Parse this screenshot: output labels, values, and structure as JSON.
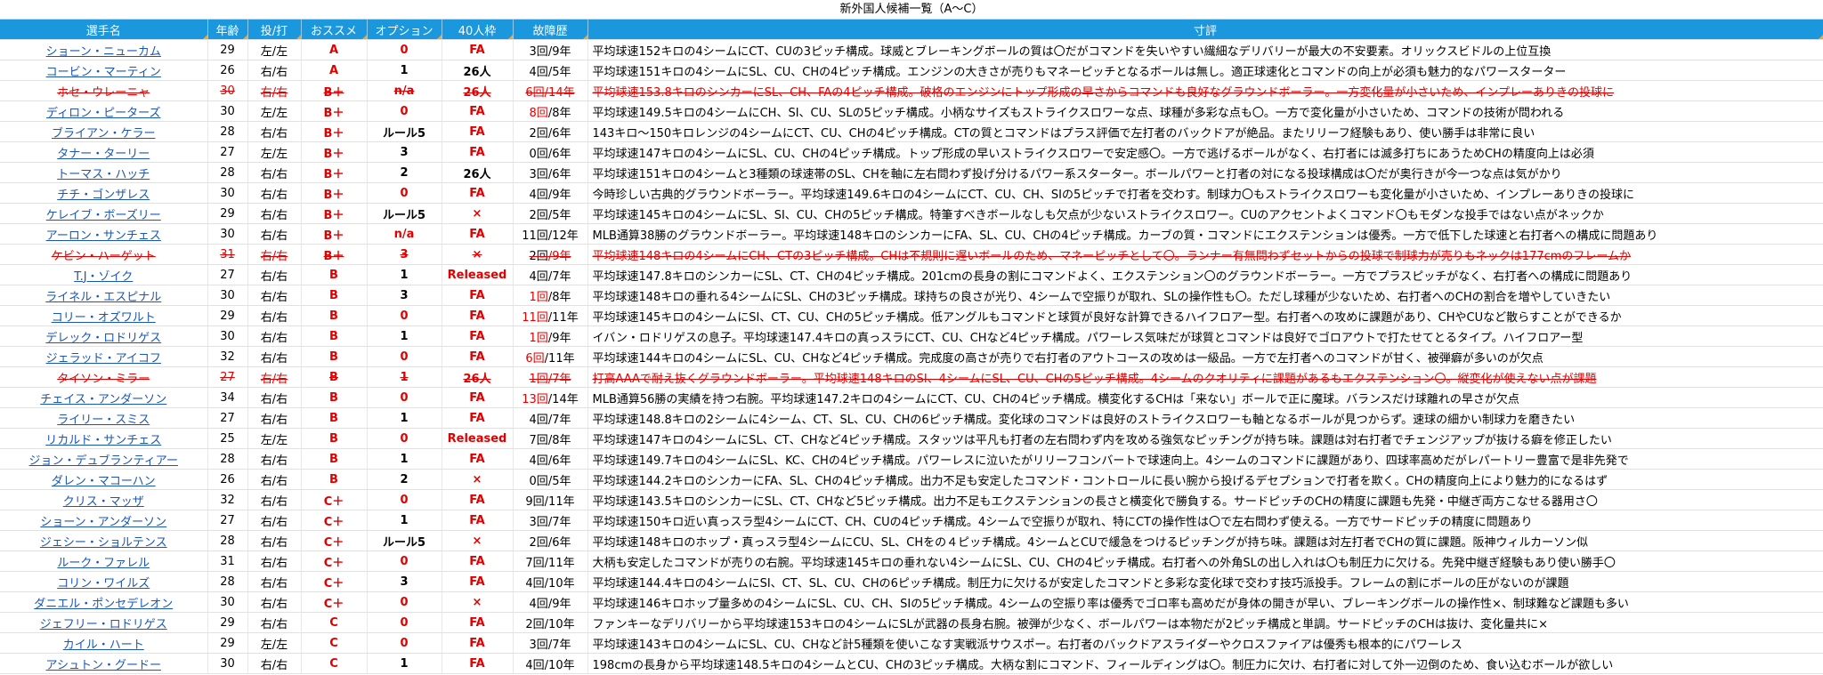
{
  "title": "新外国人候補一覧（A〜C）",
  "headers": [
    "選手名",
    "年齢",
    "投/打",
    "おススメ",
    "オプション",
    "40人枠",
    "故障歴",
    "寸評"
  ],
  "rows": [
    {
      "name": "ショーン・ニューカム",
      "age": "29",
      "hand": "左/左",
      "grade": "A",
      "option": "0",
      "option_color": "red",
      "slot": "FA",
      "slot_color": "red",
      "inj_y": "3回",
      "inj_r": "/9年",
      "comment": "平均球速152キロの4シームにCT、CUの3ピッチ構成。球威とブレーキングボールの質は〇だがコマンドを失いやすい繊細なデリバリーが最大の不安要素。オリックスビドルの上位互換",
      "struck": false
    },
    {
      "name": "コービン・マーティン",
      "age": "26",
      "hand": "右/右",
      "grade": "A",
      "option": "1",
      "option_color": "black",
      "slot": "26人",
      "slot_color": "black",
      "inj_y": "4回",
      "inj_r": "/5年",
      "comment": "平均球速151キロの4シームにSL、CU、CHの4ピッチ構成。エンジンの大きさが売りもマネーピッチとなるボールは無し。適正球速化とコマンドの向上が必須も魅力的なパワースターター",
      "struck": false
    },
    {
      "name": "ホセ・ウレーニャ",
      "age": "30",
      "hand": "右/右",
      "grade": "B＋",
      "option": "n/a",
      "option_color": "red",
      "slot": "26人",
      "slot_color": "black",
      "inj_y": "6回",
      "inj_r": "/14年",
      "comment": "平均球速153.8キロのシンカーにSL、CH、FAの4ピッチ構成。破格のエンジンにトップ形成の早さからコマンドも良好なグラウンドボーラー。一方変化量が小さいため、インプレーありきの投球に",
      "struck": true
    },
    {
      "name": "ディロン・ピーターズ",
      "age": "30",
      "hand": "左/左",
      "grade": "B＋",
      "option": "0",
      "option_color": "red",
      "slot": "FA",
      "slot_color": "red",
      "inj_y": "8回",
      "inj_r": "/8年",
      "comment": "平均球速149.5キロの4シームにCH、SI、CU、SLの5ピッチ構成。小柄なサイズもストライクスロワーな点、球種が多彩な点も〇。一方で変化量が小さいため、コマンドの技術が問われる",
      "struck": false
    },
    {
      "name": "ブライアン・ケラー",
      "age": "28",
      "hand": "右/右",
      "grade": "B＋",
      "option": "ルール5",
      "option_color": "black",
      "slot": "FA",
      "slot_color": "red",
      "inj_y": "2回",
      "inj_r": "/6年",
      "comment": "143キロ〜150キロレンジの4シームにCT、CU、CHの4ピッチ構成。CTの質とコマンドはプラス評価で左打者のバックドアが絶品。またリリーフ経験もあり、使い勝手は非常に良い",
      "struck": false
    },
    {
      "name": "タナー・ターリー",
      "age": "27",
      "hand": "左/左",
      "grade": "B＋",
      "option": "3",
      "option_color": "black",
      "slot": "FA",
      "slot_color": "red",
      "inj_y": "0回",
      "inj_r": "/6年",
      "comment": "平均球速147キロの4シームにSL、CU、CHの4ピッチ構成。トップ形成の早いストライクスロワーで安定感〇。一方で逃げるボールがなく、右打者には滅多打ちにあうためCHの精度向上は必須",
      "struck": false
    },
    {
      "name": "トーマス・ハッチ",
      "age": "28",
      "hand": "右/右",
      "grade": "B＋",
      "option": "2",
      "option_color": "black",
      "slot": "26人",
      "slot_color": "black",
      "inj_y": "3回",
      "inj_r": "/6年",
      "comment": "平均球速151キロの4シームと3種類の球速帯のSL、CHを軸に左右問わず投げ分けるパワー系スターター。ボールパワーと打者の対になる投球構成は〇だが奥行きが今一つな点は気がかり",
      "struck": false
    },
    {
      "name": "チチ・ゴンザレス",
      "age": "30",
      "hand": "右/右",
      "grade": "B＋",
      "option": "0",
      "option_color": "red",
      "slot": "FA",
      "slot_color": "red",
      "inj_y": "4回",
      "inj_r": "/9年",
      "comment": "今時珍しい古典的グラウンドボーラー。平均球速149.6キロの4シームにCT、CU、CH、SIの5ピッチで打者を交わす。制球力〇もストライクスロワーも変化量が小さいため、インプレーありきの投球に",
      "struck": false
    },
    {
      "name": "ケレイブ・ボーズリー",
      "age": "29",
      "hand": "右/右",
      "grade": "B＋",
      "option": "ルール5",
      "option_color": "black",
      "slot": "×",
      "slot_color": "red",
      "inj_y": "2回",
      "inj_r": "/5年",
      "comment": "平均球速145キロの4シームにSL、SI、CU、CHの5ピッチ構成。特筆すべきボールなしも欠点が少ないストライクスロワー。CUのアクセントよくコマンド〇もモダンな投手ではない点がネックか",
      "struck": false
    },
    {
      "name": "アーロン・サンチェス",
      "age": "30",
      "hand": "右/右",
      "grade": "B＋",
      "option": "n/a",
      "option_color": "red",
      "slot": "FA",
      "slot_color": "red",
      "inj_y": "11回",
      "inj_r": "/12年",
      "comment": "MLB通算38勝のグラウンドボーラー。平均球速148キロのシンカーにFA、SL、CU、CHの4ピッチ構成。カーブの質・コマンドにエクステンションは優秀。一方で低下した球速と右打者への構成に問題あり",
      "struck": false
    },
    {
      "name": "ケビン・ハーゲット",
      "age": "31",
      "hand": "右/右",
      "grade": "B＋",
      "option": "3",
      "option_color": "black",
      "slot": "×",
      "slot_color": "red",
      "inj_y": "2回",
      "inj_r": "/9年",
      "comment": "平均球速148キロの4シームにCH、CTの3ピッチ構成。CHは不規則に遅いボールのため、マネーピッチとして〇。ランナー有無問わずセットからの投球で制球力が売りもネックは177cmのフレームか",
      "struck": true
    },
    {
      "name": "T.J・ゾイク",
      "age": "27",
      "hand": "右/右",
      "grade": "B",
      "option": "1",
      "option_color": "black",
      "slot": "Released",
      "slot_color": "red",
      "inj_y": "4回",
      "inj_r": "/7年",
      "comment": "平均球速147.8キロのシンカーにSL、CT、CHの4ピッチ構成。201cmの長身の割にコマンドよく、エクステンション〇のグラウンドボーラー。一方でプラスピッチがなく、右打者への構成に問題あり",
      "struck": false
    },
    {
      "name": "ライネル・エスピナル",
      "age": "30",
      "hand": "右/右",
      "grade": "B",
      "option": "3",
      "option_color": "black",
      "slot": "FA",
      "slot_color": "red",
      "inj_y": "1回",
      "inj_r": "/8年",
      "comment": "平均球速148キロの垂れる4シームにSL、CHの3ピッチ構成。球持ちの良さが光り、4シームで空振りが取れ、SLの操作性も〇。ただし球種が少ないため、右打者へのCHの割合を増やしていきたい",
      "struck": false
    },
    {
      "name": "コリー・オズワルト",
      "age": "29",
      "hand": "右/右",
      "grade": "B",
      "option": "0",
      "option_color": "red",
      "slot": "FA",
      "slot_color": "red",
      "inj_y": "11回",
      "inj_r": "/11年",
      "comment": "平均球速145キロの4シームにSI、CT、CU、CHの5ピッチ構成。低アングルもコマンドと球質が良好な計算できるハイフロアー型。右打者への攻めに課題があり、CHやCUなど散らすことができるか",
      "struck": false
    },
    {
      "name": "デレック・ロドリゲス",
      "age": "30",
      "hand": "右/右",
      "grade": "B",
      "option": "1",
      "option_color": "black",
      "slot": "FA",
      "slot_color": "red",
      "inj_y": "1回",
      "inj_r": "/9年",
      "comment": "イバン・ロドリゲスの息子。平均球速147.4キロの真っスラにCT、CU、CHなど4ピッチ構成。パワーレス気味だが球質とコマンドは良好でゴロアウトで打たせてとるタイプ。ハイフロアー型",
      "struck": false
    },
    {
      "name": "ジェラッド・アイコフ",
      "age": "32",
      "hand": "右/右",
      "grade": "B",
      "option": "0",
      "option_color": "red",
      "slot": "FA",
      "slot_color": "red",
      "inj_y": "6回",
      "inj_r": "/11年",
      "comment": "平均球速144キロの4シームにSL、CU、CHなど4ピッチ構成。完成度の高さが売りで右打者のアウトコースの攻めは一級品。一方で左打者へのコマンドが甘く、被弾癖が多いのが欠点",
      "struck": false
    },
    {
      "name": "タイソン・ミラー",
      "age": "27",
      "hand": "右/右",
      "grade": "B",
      "option": "1",
      "option_color": "black",
      "slot": "26人",
      "slot_color": "black",
      "inj_y": "1回",
      "inj_r": "/7年",
      "comment": "打高AAAで耐え抜くグラウンドボーラー。平均球速148キロのSI、4シームにSL、CU、CHの5ピッチ構成。4シームのクオリティに課題があるもエクステンション〇。縦変化が使えない点が課題",
      "struck": true
    },
    {
      "name": "チェイス・アンダーソン",
      "age": "34",
      "hand": "右/右",
      "grade": "B",
      "option": "0",
      "option_color": "red",
      "slot": "FA",
      "slot_color": "red",
      "inj_y": "13回",
      "inj_r": "/14年",
      "comment": "MLB通算56勝の実績を持つ右腕。平均球速147.2キロの4シームにCT、CU、CHの4ピッチ構成。横変化するCHは「来ない」ボールで正に魔球。バランスだけ球離れの早さが欠点",
      "struck": false
    },
    {
      "name": "ライリー・スミス",
      "age": "27",
      "hand": "右/右",
      "grade": "B",
      "option": "1",
      "option_color": "black",
      "slot": "FA",
      "slot_color": "red",
      "inj_y": "4回",
      "inj_r": "/7年",
      "comment": "平均球速148.8キロの2シームに4シーム、CT、SL、CU、CHの6ピッチ構成。変化球のコマンドは良好のストライクスロワーも軸となるボールが見つからず。速球の細かい制球力を磨きたい",
      "struck": false
    },
    {
      "name": "リカルド・サンチェス",
      "age": "25",
      "hand": "左/左",
      "grade": "B",
      "option": "0",
      "option_color": "red",
      "slot": "Released",
      "slot_color": "red",
      "inj_y": "7回",
      "inj_r": "/8年",
      "comment": "平均球速147キロの4シームにSL、CT、CHなど4ピッチ構成。スタッツは平凡も打者の左右問わず内を攻める強気なピッチングが持ち味。課題は対右打者でチェンジアップが抜ける癖を修正したい",
      "struck": false
    },
    {
      "name": "ジョン・デュブランティアー",
      "age": "28",
      "hand": "右/右",
      "grade": "B",
      "option": "1",
      "option_color": "black",
      "slot": "FA",
      "slot_color": "red",
      "inj_y": "4回",
      "inj_r": "/6年",
      "comment": "平均球速149.7キロの4シームにSL、KC、CHの4ピッチ構成。パワーレスに泣いたがリリーフコンバートで球速向上。4シームのコマンドに課題があり、四球率高めだがレパートリー豊富で是非先発で",
      "struck": false
    },
    {
      "name": "ダレン・マコーハン",
      "age": "26",
      "hand": "右/右",
      "grade": "B",
      "option": "2",
      "option_color": "black",
      "slot": "×",
      "slot_color": "red",
      "inj_y": "0回",
      "inj_r": "/5年",
      "comment": "平均球速144.2キロのシンカーにFA、SL、CHの4ピッチ構成。出力不足も安定したコマンド・コントロールに長い腕から投げるデセプションで打者を欺く。CHの精度向上により魅力的になるはず",
      "struck": false
    },
    {
      "name": "クリス・マッザ",
      "age": "32",
      "hand": "右/右",
      "grade": "C＋",
      "option": "0",
      "option_color": "red",
      "slot": "FA",
      "slot_color": "red",
      "inj_y": "9回",
      "inj_r": "/11年",
      "comment": "平均球速143.5キロのシンカーにSL、CT、CHなど5ピッチ構成。出力不足もエクステンションの長さと横変化で勝負する。サードピッチのCHの精度に課題も先発・中継ぎ両方こなせる器用さ〇",
      "struck": false
    },
    {
      "name": "ショーン・アンダーソン",
      "age": "27",
      "hand": "右/右",
      "grade": "C＋",
      "option": "1",
      "option_color": "black",
      "slot": "FA",
      "slot_color": "red",
      "inj_y": "3回",
      "inj_r": "/7年",
      "comment": "平均球速150キロ近い真っスラ型4シームにCT、CH、CUの4ピッチ構成。4シームで空振りが取れ、特にCTの操作性は〇で左右問わず使える。一方でサードピッチの精度に問題あり",
      "struck": false
    },
    {
      "name": "ジェシー・ショルテンス",
      "age": "28",
      "hand": "右/右",
      "grade": "C＋",
      "option": "ルール5",
      "option_color": "black",
      "slot": "×",
      "slot_color": "red",
      "inj_y": "2回",
      "inj_r": "/6年",
      "comment": "平均球速148キロのホップ・真っスラ型4シームにCU、SL、CHをの４ピッチ構成。4シームとCUで緩急をつけるピッチングが持ち味。課題は対左打者でCHの質に課題。阪神ウィルカーソン似",
      "struck": false
    },
    {
      "name": "ルーク・ファレル",
      "age": "31",
      "hand": "右/右",
      "grade": "C＋",
      "option": "0",
      "option_color": "red",
      "slot": "FA",
      "slot_color": "red",
      "inj_y": "7回",
      "inj_r": "/11年",
      "comment": "大柄も安定したコマンドが売りの右腕。平均球速145キロの垂れない4シームにSL、CU、CHの4ピッチ構成。右打者への外角SLの出し入れは〇も制圧力に欠ける。先発中継ぎ経験もあり使い勝手〇",
      "struck": false
    },
    {
      "name": "コリン・ワイルズ",
      "age": "28",
      "hand": "右/右",
      "grade": "C＋",
      "option": "3",
      "option_color": "black",
      "slot": "FA",
      "slot_color": "red",
      "inj_y": "4回",
      "inj_r": "/10年",
      "comment": "平均球速144.4キロの4シームにSI、CT、SL、CU、CHの6ピッチ構成。制圧力に欠けるが安定したコマンドと多彩な変化球で交わす技巧派投手。フレームの割にボールの圧がないのが課題",
      "struck": false
    },
    {
      "name": "ダニエル・ポンセデレオン",
      "age": "30",
      "hand": "右/右",
      "grade": "C＋",
      "option": "0",
      "option_color": "red",
      "slot": "×",
      "slot_color": "red",
      "inj_y": "4回",
      "inj_r": "/9年",
      "comment": "平均球速146キロホップ量多めの4シームにSL、CU、CH、SIの5ピッチ構成。4シームの空振り率は優秀でゴロ率も高めだが身体の開きが早い、ブレーキングボールの操作性×、制球難など課題も多い",
      "struck": false
    },
    {
      "name": "ジェフリー・ロドリゲス",
      "age": "29",
      "hand": "右/右",
      "grade": "C",
      "option": "0",
      "option_color": "red",
      "slot": "FA",
      "slot_color": "red",
      "inj_y": "2回",
      "inj_r": "/10年",
      "comment": "ファンキーなデリバリーから平均球速153キロの4シームにSLが武器の長身右腕。被弾が少なく、ボールパワーは本物だが2ピッチ構成と単調。サードピッチのCHは抜け、変化量共に×",
      "struck": false
    },
    {
      "name": "カイル・ハート",
      "age": "29",
      "hand": "左/左",
      "grade": "C",
      "option": "0",
      "option_color": "red",
      "slot": "FA",
      "slot_color": "red",
      "inj_y": "3回",
      "inj_r": "/7年",
      "comment": "平均球速143キロの4シームにSL、CU、CHなど計5種類を使いこなす実戦派サウスポー。右打者のバックドアスライダーやクロスファイアは優秀も根本的にパワーレス",
      "struck": false
    },
    {
      "name": "アシュトン・グードー",
      "age": "30",
      "hand": "右/右",
      "grade": "C",
      "option": "1",
      "option_color": "black",
      "slot": "FA",
      "slot_color": "red",
      "inj_y": "4回",
      "inj_r": "/10年",
      "comment": "198cmの長身から平均球速148.5キロの4シームとCU、CHの3ピッチ構成。大柄な割にコマンド、フィールディングは〇。制圧力に欠け、右打者に対して外一辺倒のため、食い込むボールが欲しい",
      "struck": false
    }
  ]
}
